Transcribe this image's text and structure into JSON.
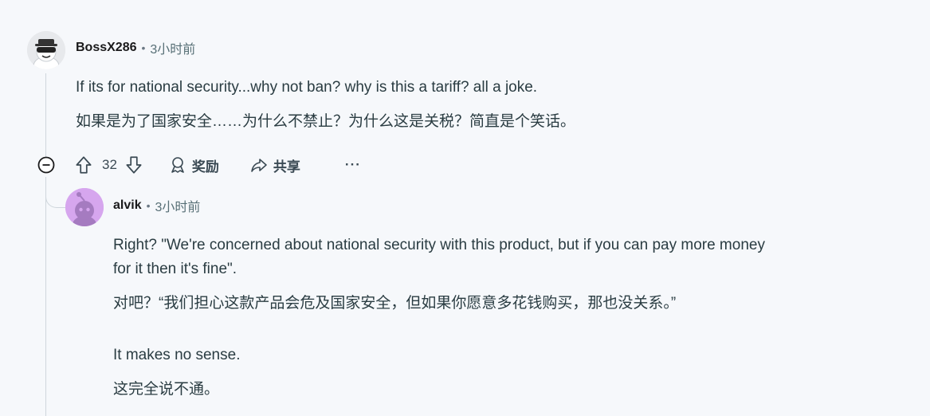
{
  "comments": [
    {
      "username": "BossX286",
      "separator": "•",
      "time": "3小时前",
      "paragraphs": [
        "If its for national security...why not ban? why is this a tariff? all a joke.",
        "如果是为了国家安全……为什么不禁止？为什么这是关税？简直是个笑话。"
      ],
      "actions": {
        "votes": "32",
        "award_label": "奖励",
        "share_label": "共享",
        "more_label": "···"
      }
    },
    {
      "username": "alvik",
      "separator": "•",
      "time": "3小时前",
      "paragraphs": [
        "Right? \"We're concerned about national security with this product, but if you can pay more money",
        "for it then it's fine\".",
        "对吧？“我们担心这款产品会危及国家安全，但如果你愿意多花钱购买，那也没关系。”",
        "It makes no sense.",
        "这完全说不通。"
      ]
    }
  ],
  "icons": {
    "collapse": "minus-circle-icon",
    "upvote": "arrow-up-icon",
    "downvote": "arrow-down-icon",
    "award": "award-ribbon-icon",
    "share": "share-arrow-icon",
    "more": "ellipsis-icon"
  },
  "colors": {
    "background": "#f6f8fb",
    "thread_line": "#cfd6dc",
    "alvik_avatar_bg": "#d6a6ee",
    "meta_text": "#576f76"
  }
}
